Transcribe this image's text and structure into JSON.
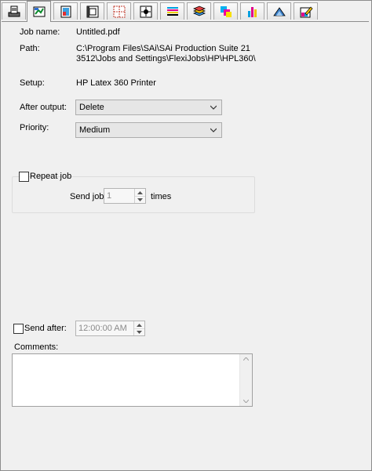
{
  "tabs": [
    {
      "icon": "printer-job-icon"
    },
    {
      "icon": "job-settings-icon"
    },
    {
      "icon": "color-page-icon"
    },
    {
      "icon": "media-icon"
    },
    {
      "icon": "tiling-icon"
    },
    {
      "icon": "marks-icon"
    },
    {
      "icon": "color-strips-icon"
    },
    {
      "icon": "layers-icon"
    },
    {
      "icon": "color-swatch-icon"
    },
    {
      "icon": "ink-bars-icon"
    },
    {
      "icon": "cut-icon"
    },
    {
      "icon": "edit-color-icon"
    }
  ],
  "job": {
    "name_label": "Job name:",
    "name_value": "Untitled.pdf",
    "path_label": "Path:",
    "path_line1": "C:\\Program Files\\SAi\\SAi Production Suite 21",
    "path_line2": "3512\\Jobs and Settings\\FlexiJobs\\HP\\HPL360\\",
    "setup_label": "Setup:",
    "setup_value": "HP Latex 360 Printer",
    "after_output_label": "After output:",
    "after_output_value": "Delete",
    "priority_label": "Priority:",
    "priority_value": "Medium"
  },
  "repeat": {
    "label": "Repeat job",
    "send_job_label": "Send job",
    "count": "1",
    "times_label": "times"
  },
  "send_after": {
    "label": "Send after:",
    "time": "12:00:00 AM"
  },
  "comments": {
    "label": "Comments:",
    "value": ""
  }
}
